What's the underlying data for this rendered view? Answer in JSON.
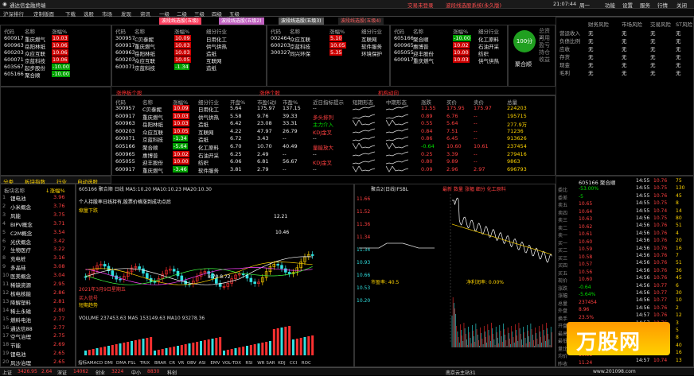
{
  "window": {
    "title": "通达信金融终端",
    "top_right": "交易未登录",
    "notice": "波段线选股系统(永久版)",
    "time": "21:07:44",
    "week": "周一",
    "controls": [
      "功能",
      "设置",
      "服务",
      "行情",
      "关闭"
    ]
  },
  "menu": [
    "沪深排行",
    "定制版面",
    "下载",
    "选股",
    "市场",
    "发现",
    "资讯",
    "一级",
    "二级",
    "三级",
    "四级",
    "五级"
  ],
  "tabs": [
    {
      "label": "波段线选股(五级)",
      "style": "red"
    },
    {
      "label": "波段线选股(五级2)",
      "style": "purple"
    },
    {
      "label": "波段线选股(五级3)",
      "style": "grey"
    },
    {
      "label": "波段线选股(五级4)",
      "style": "dark"
    }
  ],
  "top_panels": [
    {
      "h": [
        "代码",
        "名称",
        "涨幅%"
      ],
      "rows": [
        [
          "600917",
          "重庆燃气",
          "10.03",
          "r"
        ],
        [
          "600963",
          "岳阳林纸",
          "10.06",
          "r"
        ],
        [
          "600203",
          "众应互联",
          "10.06",
          "r"
        ],
        [
          "600071",
          "京蓝科技",
          "10.06",
          "r"
        ],
        [
          "603567",
          "起步股份",
          "-10.00",
          "g"
        ],
        [
          "605166",
          "聚合顺",
          "-10.00",
          "g"
        ]
      ]
    },
    {
      "h": [
        "代码",
        "名称",
        "涨幅%",
        "细分行业"
      ],
      "rows": [
        [
          "300957",
          "C贝泰妮",
          "10.09",
          "日用化工"
        ],
        [
          "600917",
          "重庆燃气",
          "10.03",
          "供气供热"
        ],
        [
          "600963",
          "岳阳林纸",
          "10.03",
          "造纸"
        ],
        [
          "600203",
          "众应互联",
          "10.05",
          "互联网"
        ],
        [
          "600071",
          "京蓝科技",
          "-1.34",
          "造纸"
        ]
      ]
    },
    {
      "h": [
        "代码",
        "名称",
        "涨幅%",
        "细分行业"
      ],
      "rows": [
        [
          "002464",
          "众应互联",
          "5.10",
          "互联网"
        ],
        [
          "600203",
          "京蓝科技",
          "10.05",
          "软件服务"
        ],
        [
          "300327",
          "同兴环保",
          "5.35",
          "环境保护"
        ]
      ]
    },
    {
      "h": [
        "代码",
        "名称",
        "涨幅%",
        "细分行业"
      ],
      "rows": [
        [
          "605166",
          "聚合顺",
          "-10.00",
          "化工原料"
        ],
        [
          "600965",
          "惠博普",
          "10.02",
          "石油开采"
        ],
        [
          "605055",
          "迎丰股份",
          "10.00",
          "纺织"
        ],
        [
          "600917",
          "重庆燃气",
          "10.03",
          "供气供热"
        ]
      ]
    }
  ],
  "account": {
    "capital": "100分",
    "labels": [
      "总资产",
      "可用",
      "盈亏",
      "持仓",
      "收益"
    ],
    "name": "聚合顺"
  },
  "right_panel": {
    "headers": [
      "",
      "财务风险",
      "市场风险",
      "交易风险",
      "ST风险"
    ],
    "rows": [
      [
        "营运收入",
        "无",
        "无",
        "无",
        "无"
      ],
      [
        "负债比例",
        "无",
        "无",
        "无",
        "无"
      ],
      [
        "应收",
        "无",
        "无",
        "无",
        "无"
      ],
      [
        "存货",
        "无",
        "无",
        "无",
        "无"
      ],
      [
        "现金",
        "无",
        "无",
        "无",
        "无"
      ],
      [
        "毛利",
        "无",
        "无",
        "无",
        "无"
      ]
    ]
  },
  "mid_sections": [
    "涨停板个股",
    "涨停个股",
    "所属板块",
    "涨跌比例",
    "机构动向"
  ],
  "main_list": {
    "headers": [
      "代码",
      "名称",
      "涨幅%",
      "细分行业",
      "开盘%",
      "市盈(动)",
      "市盈%",
      "近日指标提示",
      "短期形态",
      "中期形态",
      "涨跌",
      "买价",
      "卖价",
      "总量"
    ],
    "rows": [
      [
        "300957",
        "C贝泰妮",
        "10.09",
        "日用化工",
        "5.64",
        "175.97",
        "137.15",
        "--",
        "",
        "",
        "11.55",
        "175.95",
        "175.97",
        "224203"
      ],
      [
        "600917",
        "重庆燃气",
        "10.03",
        "供气供热",
        "5.58",
        "9.76",
        "39.33",
        "多头排列",
        "",
        "",
        "0.89",
        "6.76",
        "--",
        "195715"
      ],
      [
        "600963",
        "岳阳林纸",
        "10.03",
        "造纸",
        "6.42",
        "23.08",
        "33.31",
        "主力介入",
        "",
        "",
        "0.55",
        "5.64",
        "--",
        "277.9万"
      ],
      [
        "600203",
        "众应互联",
        "10.05",
        "互联网",
        "4.22",
        "47.97",
        "26.79",
        "KDJ金叉",
        "",
        "",
        "0.84",
        "7.51",
        "--",
        "71236"
      ],
      [
        "600071",
        "京蓝科技",
        "-1.34",
        "造纸",
        "6.72",
        "3.43",
        "--",
        "--",
        "",
        "",
        "0.86",
        "6.45",
        "--",
        "913626"
      ],
      [
        "605166",
        "聚合顺",
        "-5.64",
        "化工原料",
        "6.70",
        "10.70",
        "40.49",
        "量能放大",
        "",
        "",
        "-0.64",
        "10.60",
        "10.61",
        "237454"
      ],
      [
        "600965",
        "惠博普",
        "10.02",
        "石油开采",
        "6.25",
        "2.49",
        "--",
        "--",
        "",
        "",
        "0.25",
        "3.39",
        "--",
        "279416"
      ],
      [
        "605055",
        "迎丰股份",
        "10.00",
        "纺织",
        "6.06",
        "6.81",
        "56.67",
        "KDJ金叉",
        "",
        "",
        "0.80",
        "9.89",
        "--",
        "9863"
      ],
      [
        "600917",
        "重庆燃气",
        "-3.46",
        "软件服务",
        "3.81",
        "2.79",
        "--",
        "--",
        "",
        "",
        "0.09",
        "2.96",
        "2.97",
        "696793"
      ]
    ]
  },
  "left_list": {
    "tabs": [
      "分类",
      "板块指数",
      "行业",
      "自动选股"
    ],
    "headers": [
      "板块名称",
      "↓涨幅%"
    ],
    "rows": [
      [
        "锂电池",
        "3.96"
      ],
      [
        "小米概念",
        "3.76"
      ],
      [
        "风能",
        "3.75"
      ],
      [
        "BIPV概念",
        "3.71"
      ],
      [
        "C2M概念",
        "3.54"
      ],
      [
        "光伏概念",
        "3.42"
      ],
      [
        "生物医疗",
        "3.22"
      ],
      [
        "充电桩",
        "3.16"
      ],
      [
        "多晶硅",
        "3.08"
      ],
      [
        "医美概念",
        "3.04"
      ],
      [
        "稀缺资源",
        "2.95"
      ],
      [
        "核电核能",
        "2.86"
      ],
      [
        "降解塑料",
        "2.81"
      ],
      [
        "稀土永磁",
        "2.80"
      ],
      [
        "燃料电池",
        "2.77"
      ],
      [
        "通达信88",
        "2.77"
      ],
      [
        "空气治理",
        "2.75"
      ],
      [
        "节能",
        "2.69"
      ],
      [
        "锂电池",
        "2.65"
      ],
      [
        "风沙治理",
        "2.65"
      ]
    ]
  },
  "kline": {
    "code": "605166",
    "name": "聚合顺",
    "info": "日线 MA5:10.20 MA10:10.23 MA20:10.30",
    "ma_vals": [
      "MA5 10.64",
      "MA10 10.23",
      "MA20 10.21"
    ],
    "price_max": "12.21",
    "price_mid": "10.46",
    "low": "8.70",
    "low2": "8.72",
    "notes": [
      "个人持股率日线持有,股票价格涨到成功点后",
      "缩量下跌"
    ],
    "date": "2021年3月9日星期五",
    "signals": [
      "买入信号",
      "短期趋势"
    ],
    "volume": "VOLUME 237453.63  MA5 153149.63  MA10 93278.36",
    "bottom_tabs": [
      "指标A",
      "MACD",
      "DMI",
      "DMA",
      "FSL",
      "TRIX",
      "BRAR",
      "CR",
      "VR",
      "OBV",
      "ASI",
      "EMV",
      "VOL-TDX",
      "RSI",
      "WR",
      "SAR",
      "KDJ",
      "CCI",
      "ROC"
    ]
  },
  "intraday": {
    "title": "聚合2(日线)FSBL",
    "subtitle": "最新 数量 涨幅 细分 化工原料",
    "left_labels": [
      "11.66",
      "11.52",
      "11.36",
      "11.34",
      "11.34",
      "10.93",
      "10.66",
      "10.53",
      "10.20"
    ],
    "vol_label": "市盈率: 40.5",
    "change": "净利润率: 0.00%"
  },
  "order_book": {
    "code": "605166",
    "name": "聚合顺",
    "labels": [
      "委比",
      "委差",
      "卖五",
      "卖四",
      "卖三",
      "卖二",
      "卖一",
      "买一",
      "买二",
      "买三",
      "买四",
      "买五",
      "现价",
      "涨跌",
      "涨幅",
      "总量",
      "外盘",
      "换手",
      "开盘",
      "最高",
      "最低",
      "量比",
      "均价",
      "昨收"
    ],
    "values": [
      "-53.00%",
      "-5",
      "10.65",
      "10.64",
      "10.63",
      "10.62",
      "10.61",
      "10.60",
      "10.59",
      "10.58",
      "10.57",
      "10.56",
      "10.60",
      "-0.64",
      "-5.64%",
      "237454",
      "8.96",
      "23.5%",
      "10.52",
      "10.70",
      "10.08",
      "1.36",
      "10.31",
      "11.24"
    ],
    "ticks": [
      [
        "14:55",
        "10.76",
        "75"
      ],
      [
        "14:55",
        "10.75",
        "130"
      ],
      [
        "14:55",
        "10.76",
        "45"
      ],
      [
        "14:55",
        "10.75",
        "8"
      ],
      [
        "14:55",
        "10.74",
        "14"
      ],
      [
        "14:56",
        "10.75",
        "80"
      ],
      [
        "14:56",
        "10.76",
        "51"
      ],
      [
        "14:56",
        "10.76",
        "4"
      ],
      [
        "14:56",
        "10.76",
        "20"
      ],
      [
        "14:56",
        "10.76",
        "16"
      ],
      [
        "14:56",
        "10.76",
        "7"
      ],
      [
        "14:56",
        "10.76",
        "51"
      ],
      [
        "14:56",
        "10.76",
        "36"
      ],
      [
        "14:56",
        "10.76",
        "45"
      ],
      [
        "14:56",
        "10.77",
        "6"
      ],
      [
        "14:56",
        "10.77",
        "30"
      ],
      [
        "14:56",
        "10.77",
        "10"
      ],
      [
        "14:56",
        "10.76",
        "2"
      ],
      [
        "14:57",
        "10.76",
        "12"
      ],
      [
        "14:57",
        "10.76",
        "3"
      ],
      [
        "14:57",
        "10.77",
        "5"
      ],
      [
        "14:57",
        "10.75",
        "8"
      ],
      [
        "14:57",
        "10.75",
        "40"
      ],
      [
        "14:57",
        "10.75",
        "16"
      ],
      [
        "14:57",
        "10.74",
        "13"
      ]
    ]
  },
  "status": {
    "items": [
      "上证",
      "3426.95",
      "2.64",
      "深证",
      "14062",
      "创业",
      "3224",
      "中小",
      "8830",
      "科创"
    ],
    "right": "南京云主站31"
  },
  "watermark": {
    "text": "万股网",
    "url": "www.201098.com"
  }
}
